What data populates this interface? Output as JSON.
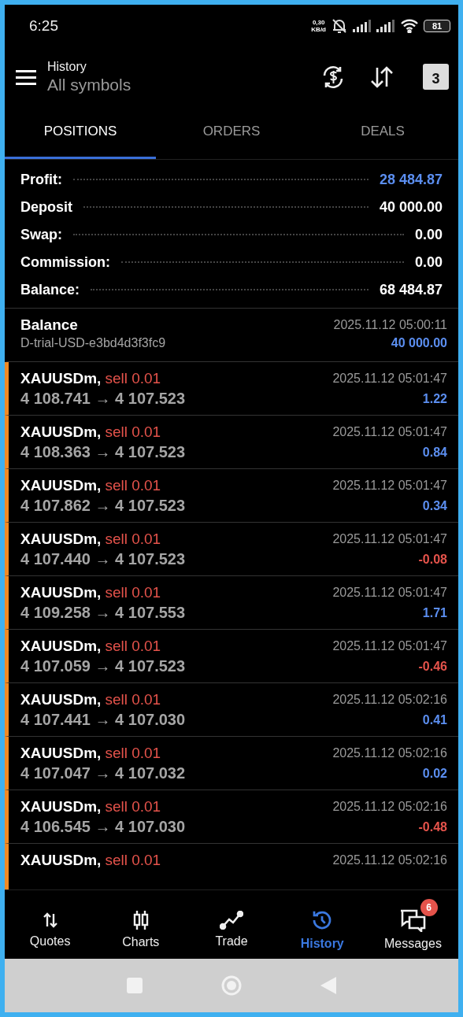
{
  "status_bar": {
    "time": "6:25",
    "data_speed": [
      "0,30",
      "KB/d"
    ],
    "battery": "81"
  },
  "header": {
    "title": "History",
    "subtitle": "All symbols",
    "calendar_day": "3"
  },
  "tabs": [
    {
      "label": "POSITIONS",
      "selected": true
    },
    {
      "label": "ORDERS",
      "selected": false
    },
    {
      "label": "DEALS",
      "selected": false
    }
  ],
  "summary": [
    {
      "label": "Profit:",
      "value": "28 484.87",
      "color": "#5b8ef0"
    },
    {
      "label": "Deposit",
      "value": "40 000.00",
      "color": "#ffffff"
    },
    {
      "label": "Swap:",
      "value": "0.00",
      "color": "#ffffff"
    },
    {
      "label": "Commission:",
      "value": "0.00",
      "color": "#ffffff"
    },
    {
      "label": "Balance:",
      "value": "68 484.87",
      "color": "#ffffff"
    }
  ],
  "balance_entry": {
    "title": "Balance",
    "account": "D-trial-USD-e3bd4d3f3fc9",
    "time": "2025.11.12 05:00:11",
    "amount": "40 000.00"
  },
  "deals": [
    {
      "symbol": "XAUUSDm,",
      "side": "sell 0.01",
      "time": "2025.11.12 05:01:47",
      "prices": "4 108.741 → 4 107.523",
      "profit": "1.22",
      "color": "#5b8ef0"
    },
    {
      "symbol": "XAUUSDm,",
      "side": "sell 0.01",
      "time": "2025.11.12 05:01:47",
      "prices": "4 108.363 → 4 107.523",
      "profit": "0.84",
      "color": "#5b8ef0"
    },
    {
      "symbol": "XAUUSDm,",
      "side": "sell 0.01",
      "time": "2025.11.12 05:01:47",
      "prices": "4 107.862 → 4 107.523",
      "profit": "0.34",
      "color": "#5b8ef0"
    },
    {
      "symbol": "XAUUSDm,",
      "side": "sell 0.01",
      "time": "2025.11.12 05:01:47",
      "prices": "4 107.440 → 4 107.523",
      "profit": "-0.08",
      "color": "#e5534b"
    },
    {
      "symbol": "XAUUSDm,",
      "side": "sell 0.01",
      "time": "2025.11.12 05:01:47",
      "prices": "4 109.258 → 4 107.553",
      "profit": "1.71",
      "color": "#5b8ef0"
    },
    {
      "symbol": "XAUUSDm,",
      "side": "sell 0.01",
      "time": "2025.11.12 05:01:47",
      "prices": "4 107.059 → 4 107.523",
      "profit": "-0.46",
      "color": "#e5534b"
    },
    {
      "symbol": "XAUUSDm,",
      "side": "sell 0.01",
      "time": "2025.11.12 05:02:16",
      "prices": "4 107.441 → 4 107.030",
      "profit": "0.41",
      "color": "#5b8ef0"
    },
    {
      "symbol": "XAUUSDm,",
      "side": "sell 0.01",
      "time": "2025.11.12 05:02:16",
      "prices": "4 107.047 → 4 107.032",
      "profit": "0.02",
      "color": "#5b8ef0"
    },
    {
      "symbol": "XAUUSDm,",
      "side": "sell 0.01",
      "time": "2025.11.12 05:02:16",
      "prices": "4 106.545 → 4 107.030",
      "profit": "-0.48",
      "color": "#e5534b"
    },
    {
      "symbol": "XAUUSDm,",
      "side": "sell 0.01",
      "time": "2025.11.12 05:02:16"
    }
  ],
  "bottom_nav": [
    {
      "label": "Quotes",
      "selected": false,
      "kind": "quotes"
    },
    {
      "label": "Charts",
      "selected": false,
      "kind": "charts"
    },
    {
      "label": "Trade",
      "selected": false,
      "kind": "trade"
    },
    {
      "label": "History",
      "selected": true,
      "kind": "history"
    },
    {
      "label": "Messages",
      "selected": false,
      "kind": "messages",
      "badge": "6"
    }
  ]
}
